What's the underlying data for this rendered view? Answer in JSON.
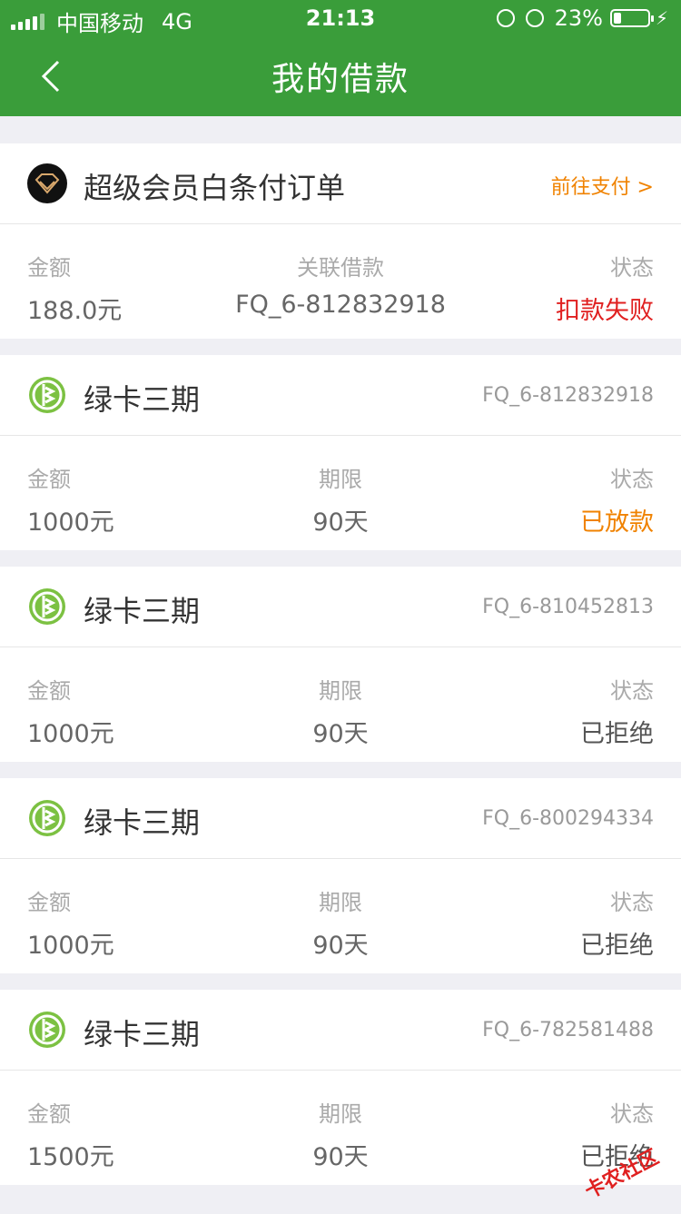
{
  "status_bar": {
    "carrier": "中国移动",
    "network": "4G",
    "time": "21:13",
    "battery": "23%",
    "battery_level": 0.23
  },
  "nav": {
    "title": "我的借款"
  },
  "orders": [
    {
      "type": "vip",
      "title": "超级会员白条付订单",
      "action": "前往支付 >",
      "col1_label": "金额",
      "col1_value": "188.0元",
      "col2_label": "关联借款",
      "col2_value": "FQ_6-812832918",
      "col3_label": "状态",
      "col3_value": "扣款失败",
      "status_color": "#e02020"
    },
    {
      "type": "loan",
      "title": "绿卡三期",
      "code": "FQ_6-812832918",
      "col1_label": "金额",
      "col1_value": "1000元",
      "col2_label": "期限",
      "col2_value": "90天",
      "col3_label": "状态",
      "col3_value": "已放款",
      "status_color": "#f08200"
    },
    {
      "type": "loan",
      "title": "绿卡三期",
      "code": "FQ_6-810452813",
      "col1_label": "金额",
      "col1_value": "1000元",
      "col2_label": "期限",
      "col2_value": "90天",
      "col3_label": "状态",
      "col3_value": "已拒绝",
      "status_color": "#555555"
    },
    {
      "type": "loan",
      "title": "绿卡三期",
      "code": "FQ_6-800294334",
      "col1_label": "金额",
      "col1_value": "1000元",
      "col2_label": "期限",
      "col2_value": "90天",
      "col3_label": "状态",
      "col3_value": "已拒绝",
      "status_color": "#555555"
    },
    {
      "type": "loan",
      "title": "绿卡三期",
      "code": "FQ_6-782581488",
      "col1_label": "金额",
      "col1_value": "1500元",
      "col2_label": "期限",
      "col2_value": "90天",
      "col3_label": "状态",
      "col3_value": "已拒绝",
      "status_color": "#555555"
    }
  ],
  "watermark": {
    "text": "卡农社区"
  },
  "colors": {
    "brand_green": "#3a9d3a",
    "accent_orange": "#f08200",
    "error_red": "#e02020"
  }
}
